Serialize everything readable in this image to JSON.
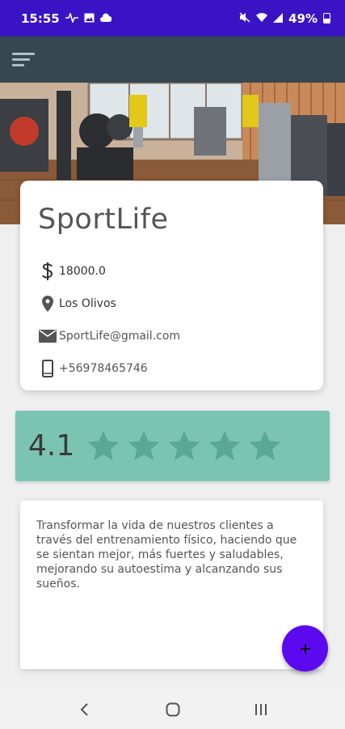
{
  "status_bar": {
    "time": "15:55",
    "battery": "49%"
  },
  "gym": {
    "name": "SportLife",
    "price": "18000.0",
    "location": "Los Olivos",
    "email": "SportLife@gmail.com",
    "phone": "+56978465746"
  },
  "rating": {
    "value": "4.1",
    "stars_total": 5,
    "card_color": "#7bc4b2"
  },
  "description": "Transformar la vida de nuestros clientes a través del entrenamiento físico, haciendo que se sientan mejor, más fuertes y saludables, mejorando su autoestima y alcanzando sus sueños.",
  "fab": {
    "label": "+"
  },
  "colors": {
    "status_bar": "#3a14c4",
    "app_bar": "#37474f",
    "fab": "#5b0af0"
  }
}
